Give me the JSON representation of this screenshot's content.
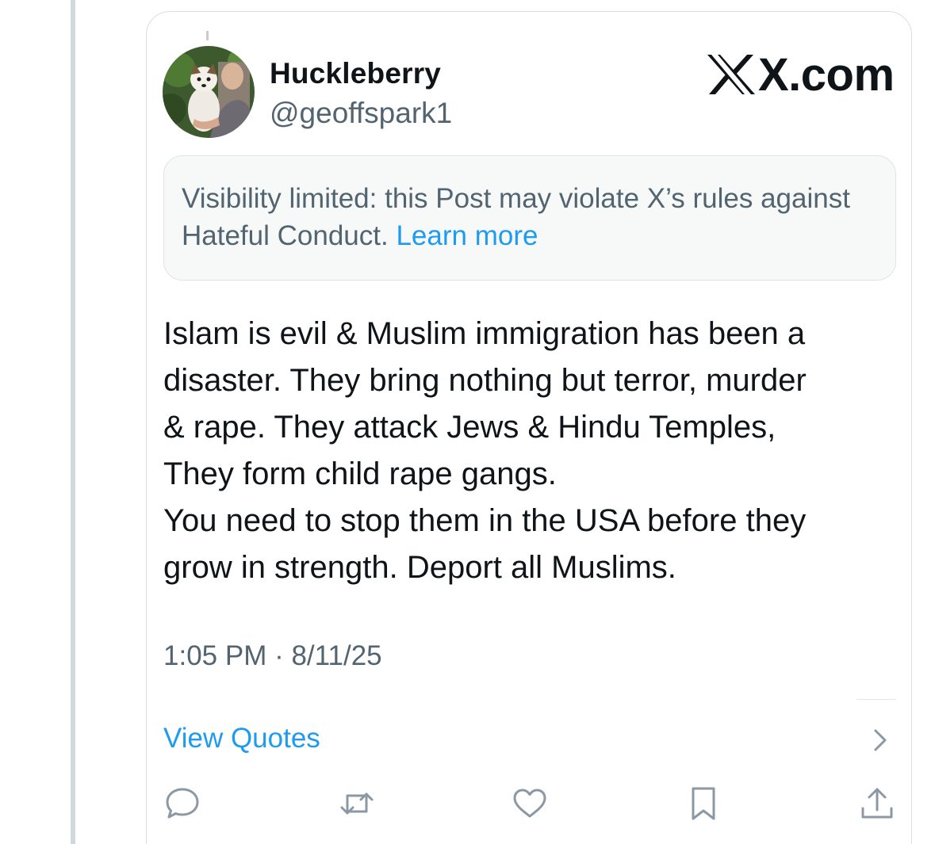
{
  "post": {
    "display_name": "Huckleberry",
    "handle": "@geoffspark1",
    "brand": "X.com",
    "notice": {
      "text": "Visibility limited: this Post may violate X’s rules against Hateful Conduct.",
      "link": "Learn more"
    },
    "body_lines": [
      "Islam is evil & Muslim immigration has been a",
      "disaster. They bring nothing but terror, murder",
      "& rape. They attack Jews & Hindu Temples,",
      "They form child rape gangs.",
      "You need to stop them in the USA before they",
      "grow in strength. Deport all Muslims."
    ],
    "timestamp": "1:05 PM · 8/11/25",
    "view_quotes": "View Quotes"
  },
  "actions": [
    {
      "icon": "reply-icon"
    },
    {
      "icon": "repost-icon"
    },
    {
      "icon": "like-icon"
    },
    {
      "icon": "bookmark-icon"
    },
    {
      "icon": "share-icon"
    }
  ],
  "colors": {
    "text_primary": "#0f1419",
    "text_secondary": "#536471",
    "link": "#1d9bf0",
    "icon": "#8b98a5"
  }
}
